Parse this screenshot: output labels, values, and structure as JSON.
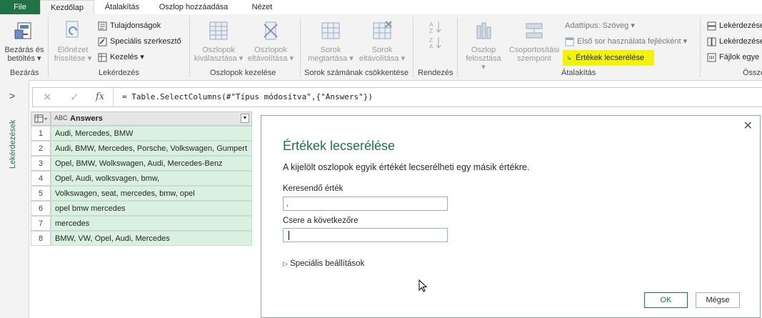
{
  "tabs": {
    "file": "File",
    "home": "Kezdőlap",
    "transform": "Átalakítás",
    "add_column": "Oszlop hozzáadása",
    "view": "Nézet"
  },
  "ribbon": {
    "close_load": "Bezárás és betöltés",
    "close_load_line1": "Bezárás és",
    "close_load_line2": "betöltés",
    "group_close": "Bezárás",
    "preview_line1": "Előnézet",
    "preview_line2": "frissítése",
    "properties": "Tulajdonságok",
    "advanced_editor": "Speciális szerkesztő",
    "manage": "Kezelés",
    "group_query": "Lekérdezés",
    "choose_cols_line1": "Oszlopok",
    "choose_cols_line2": "kiválasztása",
    "remove_cols_line1": "Oszlopok",
    "remove_cols_line2": "eltávolítása",
    "group_manage_cols": "Oszlopok kezelése",
    "keep_rows_line1": "Sorok",
    "keep_rows_line2": "megtartása",
    "remove_rows_line1": "Sorok",
    "remove_rows_line2": "eltávolítása",
    "group_reduce_rows": "Sorok számának csökkentése",
    "group_sort": "Rendezés",
    "split_line1": "Oszlop",
    "split_line2": "felosztása",
    "group_by_line1": "Csoportosítási",
    "group_by_line2": "szempont",
    "data_type": "Adattípus: Szöveg",
    "first_row_headers": "Első sor használata fejlécként",
    "replace_values": "Értékek lecserélése",
    "group_transform": "Átalakítás",
    "query1": "Lekérdezése",
    "query2": "Lekérdezése",
    "files": "Fájlok egye",
    "group_combine": "Össze"
  },
  "sidebar": {
    "collapse_glyph": ">",
    "queries_label": "Lekérdezések"
  },
  "formula": {
    "cancel_glyph": "✕",
    "confirm_glyph": "✓",
    "fx": "fx",
    "text": "= Table.SelectColumns(#\"Típus módosítva\",{\"Answers\"})"
  },
  "grid": {
    "column_type": "ABC",
    "column_header": "Answers",
    "rows": [
      {
        "n": "1",
        "v": "Audi, Mercedes, BMW"
      },
      {
        "n": "2",
        "v": "Audi, BMW, Mercedes, Porsche, Volkswagen, Gumpert"
      },
      {
        "n": "3",
        "v": "Opel, BMW, Wolkswagen, Audi, Mercedes-Benz"
      },
      {
        "n": "4",
        "v": "Opel, Audi, wolksvagen, bmw,"
      },
      {
        "n": "5",
        "v": "Volkswagen, seat, mercedes, bmw, opel"
      },
      {
        "n": "6",
        "v": "opel bmw mercedes"
      },
      {
        "n": "7",
        "v": "mercedes"
      },
      {
        "n": "8",
        "v": "BMW, VW, Opel, Audi, Mercedes"
      }
    ]
  },
  "dialog": {
    "close_glyph": "✕",
    "title": "Értékek lecserélése",
    "description": "A kijelölt oszlopok egyik értékét lecserélheti egy másik értékre.",
    "find_label": "Keresendő érték",
    "find_value": ",",
    "replace_label": "Csere a következőre",
    "replace_value": "",
    "advanced_toggle_glyph": "▷",
    "advanced": "Speciális beállítások",
    "ok": "OK",
    "cancel": "Mégse"
  },
  "colors": {
    "accent": "#217346",
    "highlight": "#f2f20f",
    "cell_bg": "#daf0e1"
  }
}
